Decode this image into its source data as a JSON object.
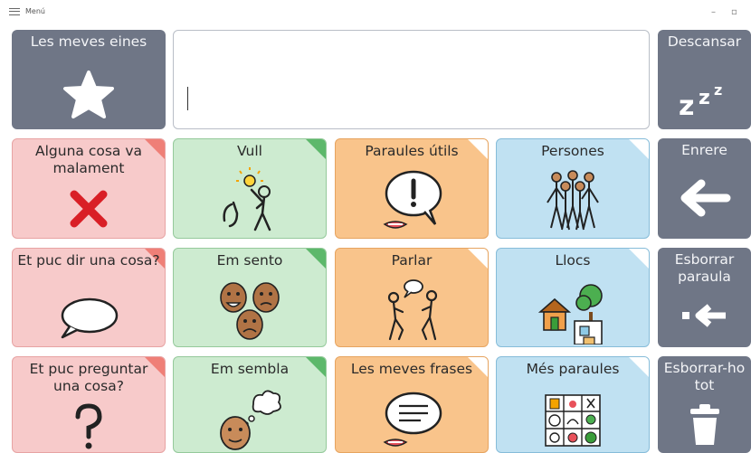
{
  "window": {
    "menu_label": "Menú",
    "minimize": "–",
    "maximize": "▫"
  },
  "tiles": {
    "tools": "Les meves eines",
    "rest": "Descansar",
    "wrong": "Alguna cosa va malament",
    "want": "Vull",
    "useful": "Paraules útils",
    "people": "Persones",
    "back": "Enrere",
    "say": "Et puc dir una cosa?",
    "feel": "Em sento",
    "talk": "Parlar",
    "places": "Llocs",
    "del_word": "Esborrar paraula",
    "ask": "Et puc preguntar una cosa?",
    "seem": "Em sembla",
    "phrases": "Les meves frases",
    "more": "Més paraules",
    "del_all": "Esborrar-ho tot"
  },
  "message_box": {
    "value": ""
  },
  "colors": {
    "gray": "#6f7686",
    "red": "#f7caca",
    "green": "#cdebd0",
    "orange": "#f9c48b",
    "blue": "#c0e1f2"
  }
}
